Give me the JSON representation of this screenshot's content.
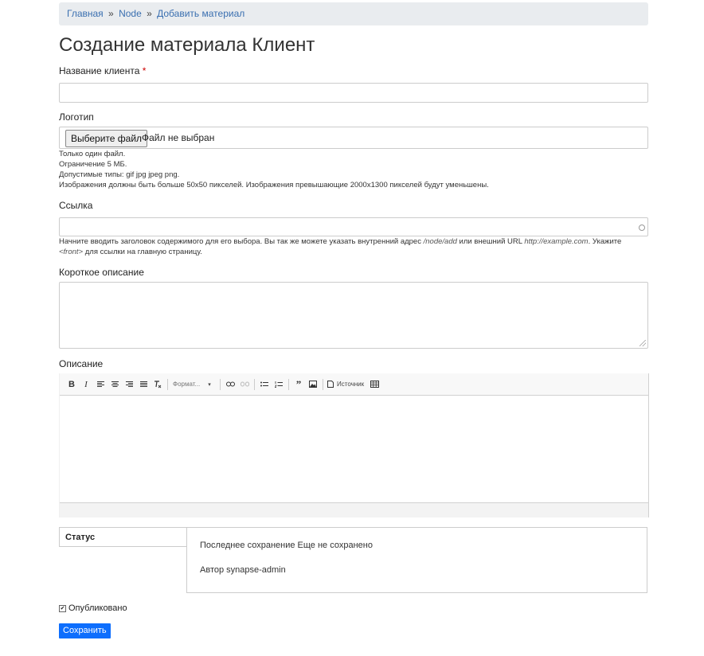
{
  "breadcrumb": {
    "home": "Главная",
    "sep1": "»",
    "node": "Node",
    "sep2": "»",
    "current": "Добавить материал"
  },
  "page_title": "Создание материала Клиент",
  "fields": {
    "client_name": {
      "label": "Название клиента",
      "required_mark": "*",
      "value": ""
    },
    "logo": {
      "label": "Логотип",
      "button": "Выберите файл",
      "file_status": "Файл не выбран",
      "help": [
        "Только один файл.",
        "Ограничение 5 МБ.",
        "Допустимые типы: gif jpg jpeg png.",
        "Изображения должны быть больше 50x50 пикселей. Изображения превышающие 2000x1300 пикселей будут уменьшены."
      ]
    },
    "link": {
      "label": "Ссылка",
      "value": "",
      "help_part1": "Начните вводить заголовок содержимого для его выбора. Вы так же можете указать внутренний адрес ",
      "help_node": "/node/add",
      "help_part2": " или внешний URL ",
      "help_url": "http://example.com",
      "help_part3": ". Укажите",
      "help_front": "<front>",
      "help_part4": " для ссылки на главную страницу."
    },
    "short_desc": {
      "label": "Короткое описание",
      "value": ""
    },
    "description": {
      "label": "Описание",
      "toolbar": {
        "bold": "B",
        "italic": "I",
        "format": "Формат...",
        "source": "Источник"
      }
    }
  },
  "status": {
    "tab": "Статус",
    "last_saved": "Последнее сохранение Еще не сохранено",
    "author": "Автор synapse-admin"
  },
  "published": {
    "label": "Опубликовано",
    "checked": true
  },
  "save_button": "Сохранить",
  "colors": {
    "link": "#3a6fb0",
    "primary": "#0d6efd",
    "required": "#cc0000",
    "breadcrumb_bg": "#e9ecef"
  }
}
